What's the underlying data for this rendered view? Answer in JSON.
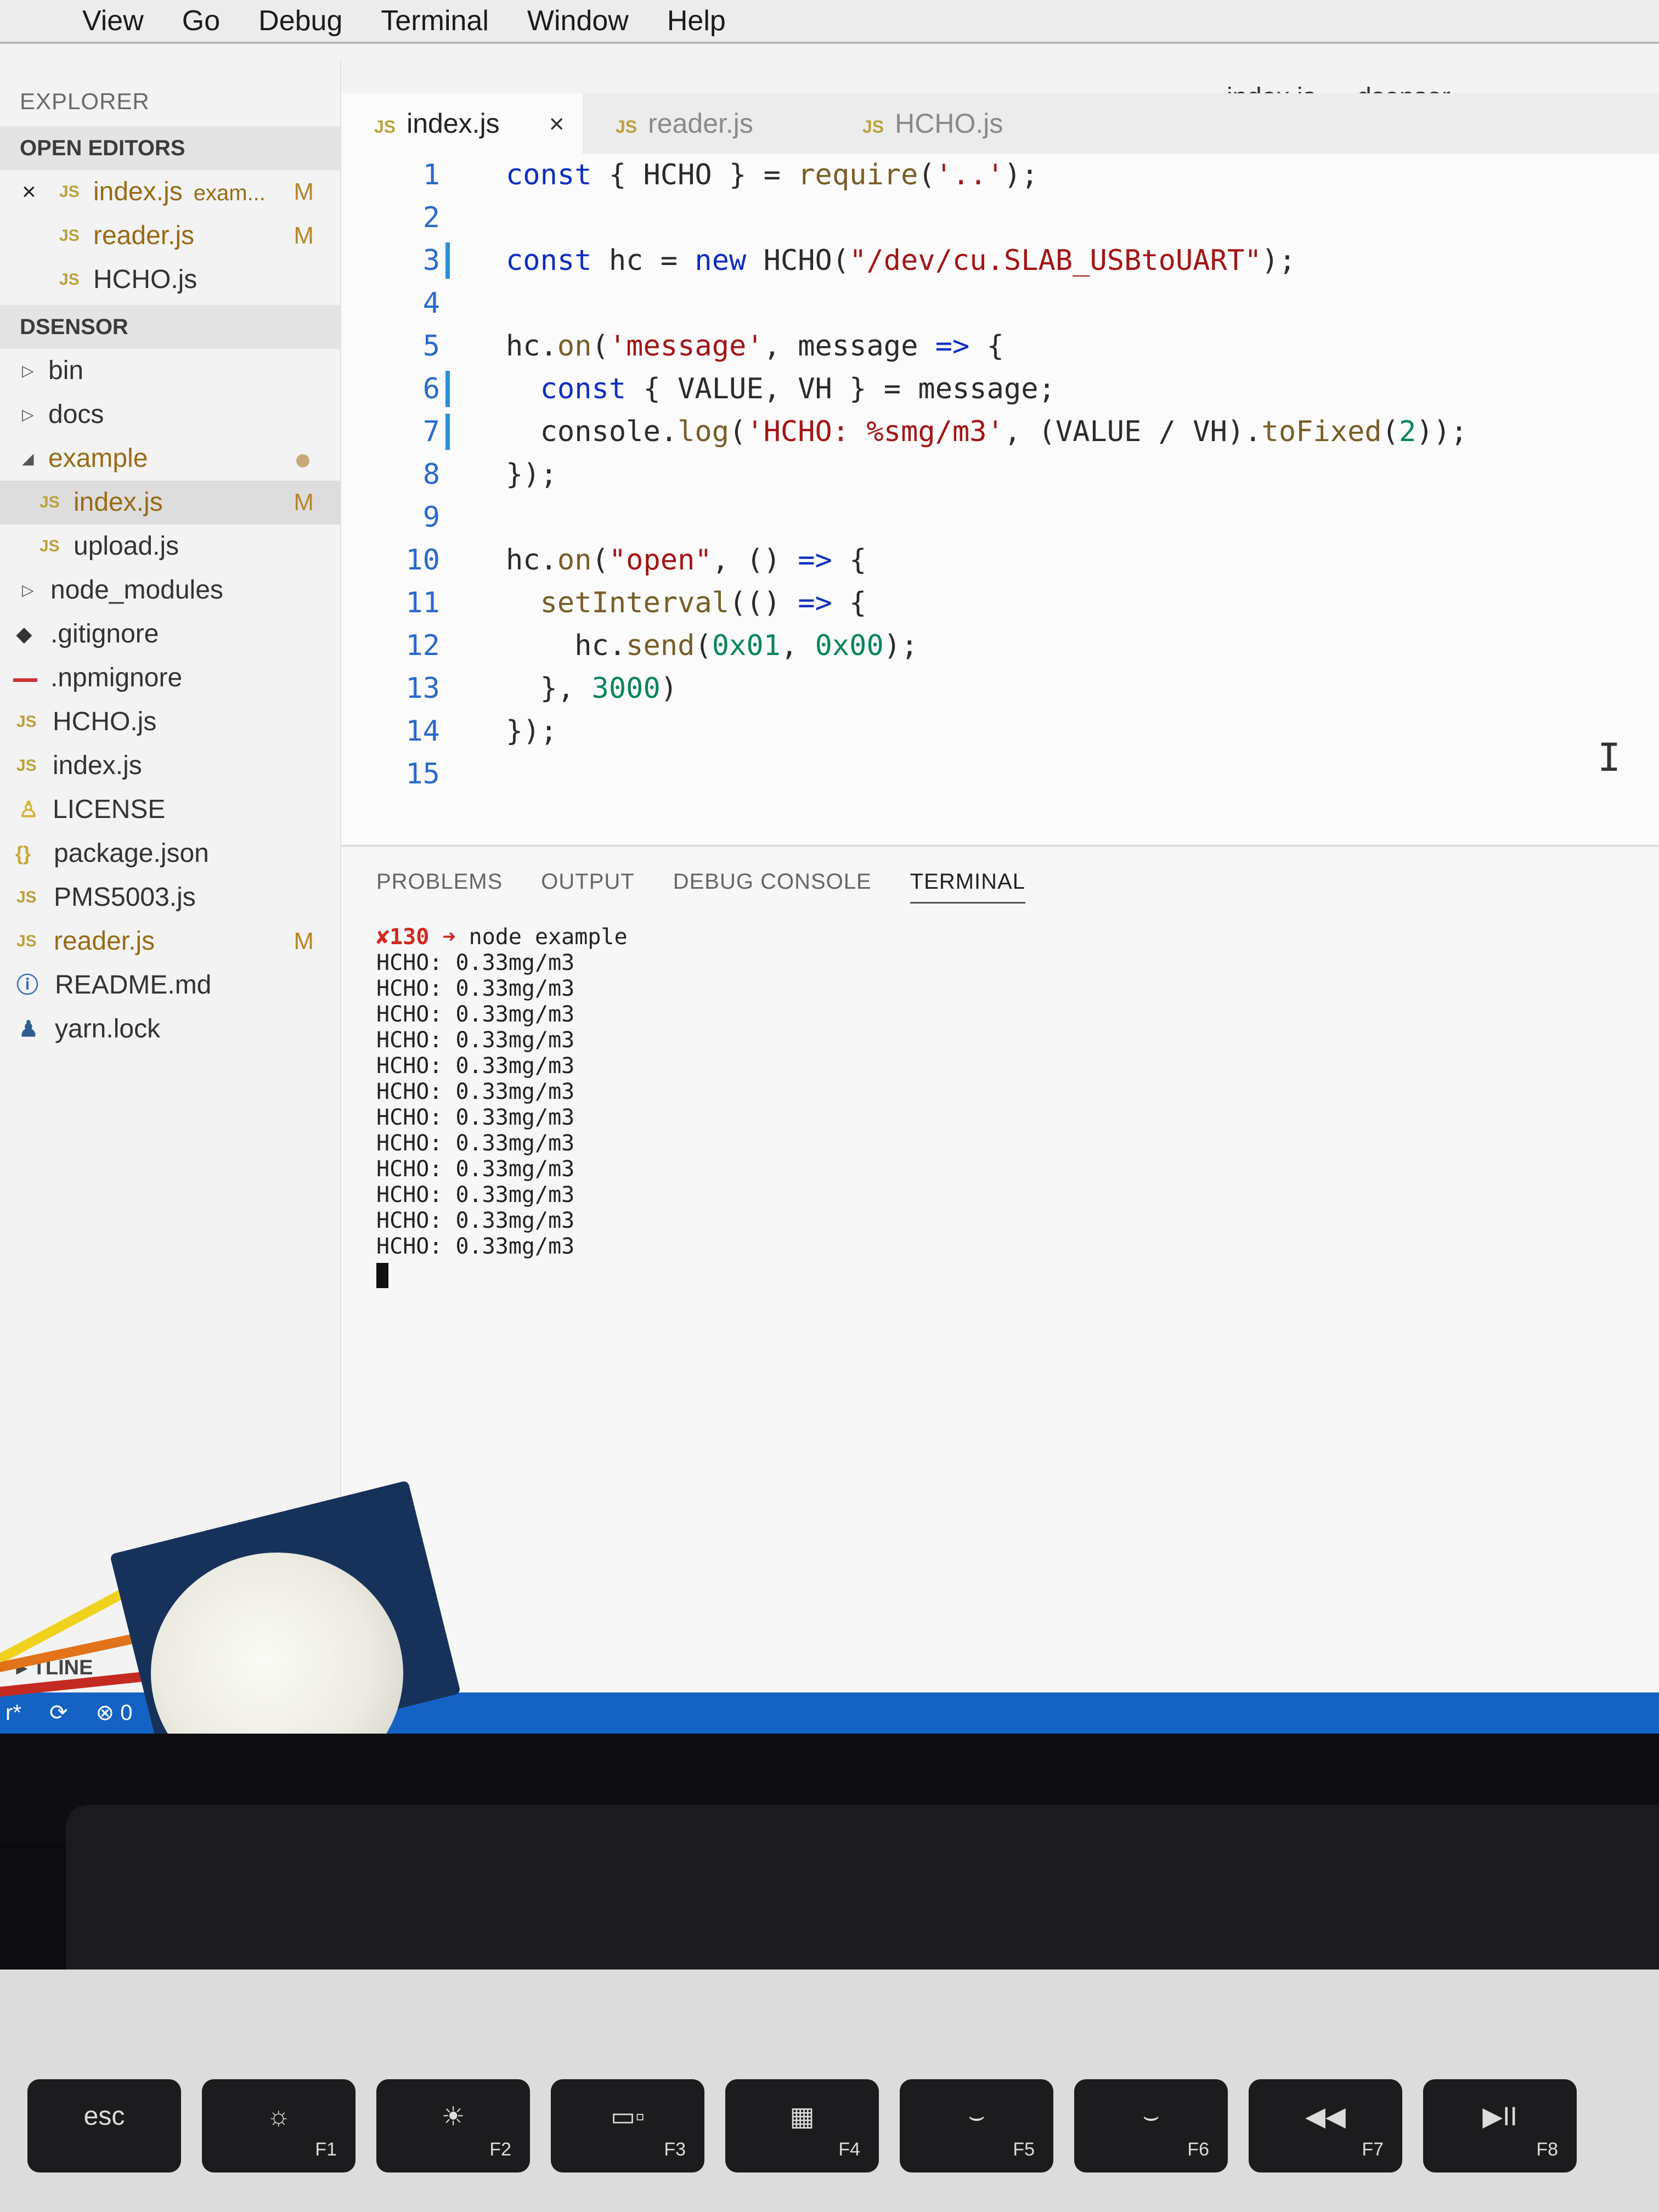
{
  "menubar": {
    "items": [
      "View",
      "Go",
      "Debug",
      "Terminal",
      "Window",
      "Help"
    ]
  },
  "window_title": "index.js — dsensor",
  "sidebar": {
    "heading": "EXPLORER",
    "open_editors_title": "OPEN EDITORS",
    "open_editors": [
      {
        "name": "index.js",
        "desc": "exam...",
        "badge": "M",
        "close": "×"
      },
      {
        "name": "reader.js",
        "badge": "M"
      },
      {
        "name": "HCHO.js",
        "badge": ""
      }
    ],
    "project_title": "DSENSOR",
    "tree": [
      {
        "name": "bin",
        "type": "folder"
      },
      {
        "name": "docs",
        "type": "folder"
      },
      {
        "name": "example",
        "type": "folder-open"
      },
      {
        "name": "index.js",
        "type": "file",
        "badge": "M"
      },
      {
        "name": "upload.js",
        "type": "file"
      },
      {
        "name": "node_modules",
        "type": "folder"
      },
      {
        "name": ".gitignore",
        "type": "file"
      },
      {
        "name": ".npmignore",
        "type": "file"
      },
      {
        "name": "HCHO.js",
        "type": "file"
      },
      {
        "name": "index.js",
        "type": "file"
      },
      {
        "name": "LICENSE",
        "type": "file"
      },
      {
        "name": "package.json",
        "type": "file"
      },
      {
        "name": "PMS5003.js",
        "type": "file"
      },
      {
        "name": "reader.js",
        "type": "file",
        "badge": "M"
      },
      {
        "name": "README.md",
        "type": "file"
      },
      {
        "name": "yarn.lock",
        "type": "file"
      }
    ],
    "outline_title": "TLINE"
  },
  "tabs": [
    {
      "label": "index.js",
      "close": "×"
    },
    {
      "label": "reader.js"
    },
    {
      "label": "HCHO.js"
    }
  ],
  "file_icon_text": "JS",
  "code": {
    "line_numbers": [
      "1",
      "2",
      "3",
      "4",
      "5",
      "6",
      "7",
      "8",
      "9",
      "10",
      "11",
      "12",
      "13",
      "14",
      "15"
    ]
  },
  "panel": {
    "tabs": [
      "PROBLEMS",
      "OUTPUT",
      "DEBUG CONSOLE",
      "TERMINAL"
    ],
    "prompt_status": "✘130",
    "prompt_arrow": "➜",
    "prompt_command": "node example",
    "output_line": "HCHO: 0.33mg/m3",
    "output_count": 12
  },
  "statusbar": {
    "branch": "r*",
    "sync_icon": "sync-icon",
    "errors": "0"
  },
  "keyboard": {
    "keys": [
      {
        "label": "esc",
        "fn": ""
      },
      {
        "label": "☼",
        "fn": "F1"
      },
      {
        "label": "☀",
        "fn": "F2"
      },
      {
        "label": "▭▫",
        "fn": "F3"
      },
      {
        "label": "▦",
        "fn": "F4"
      },
      {
        "label": "⌣",
        "fn": "F5"
      },
      {
        "label": "⌣",
        "fn": "F6"
      },
      {
        "label": "◀◀",
        "fn": "F7"
      },
      {
        "label": "▶II",
        "fn": "F8"
      }
    ]
  },
  "colors": {
    "statusbar": "#1463c4",
    "keyword": "#0d2fbf",
    "string": "#a31515",
    "modified": "#b8862b",
    "error": "#d02a1f"
  }
}
